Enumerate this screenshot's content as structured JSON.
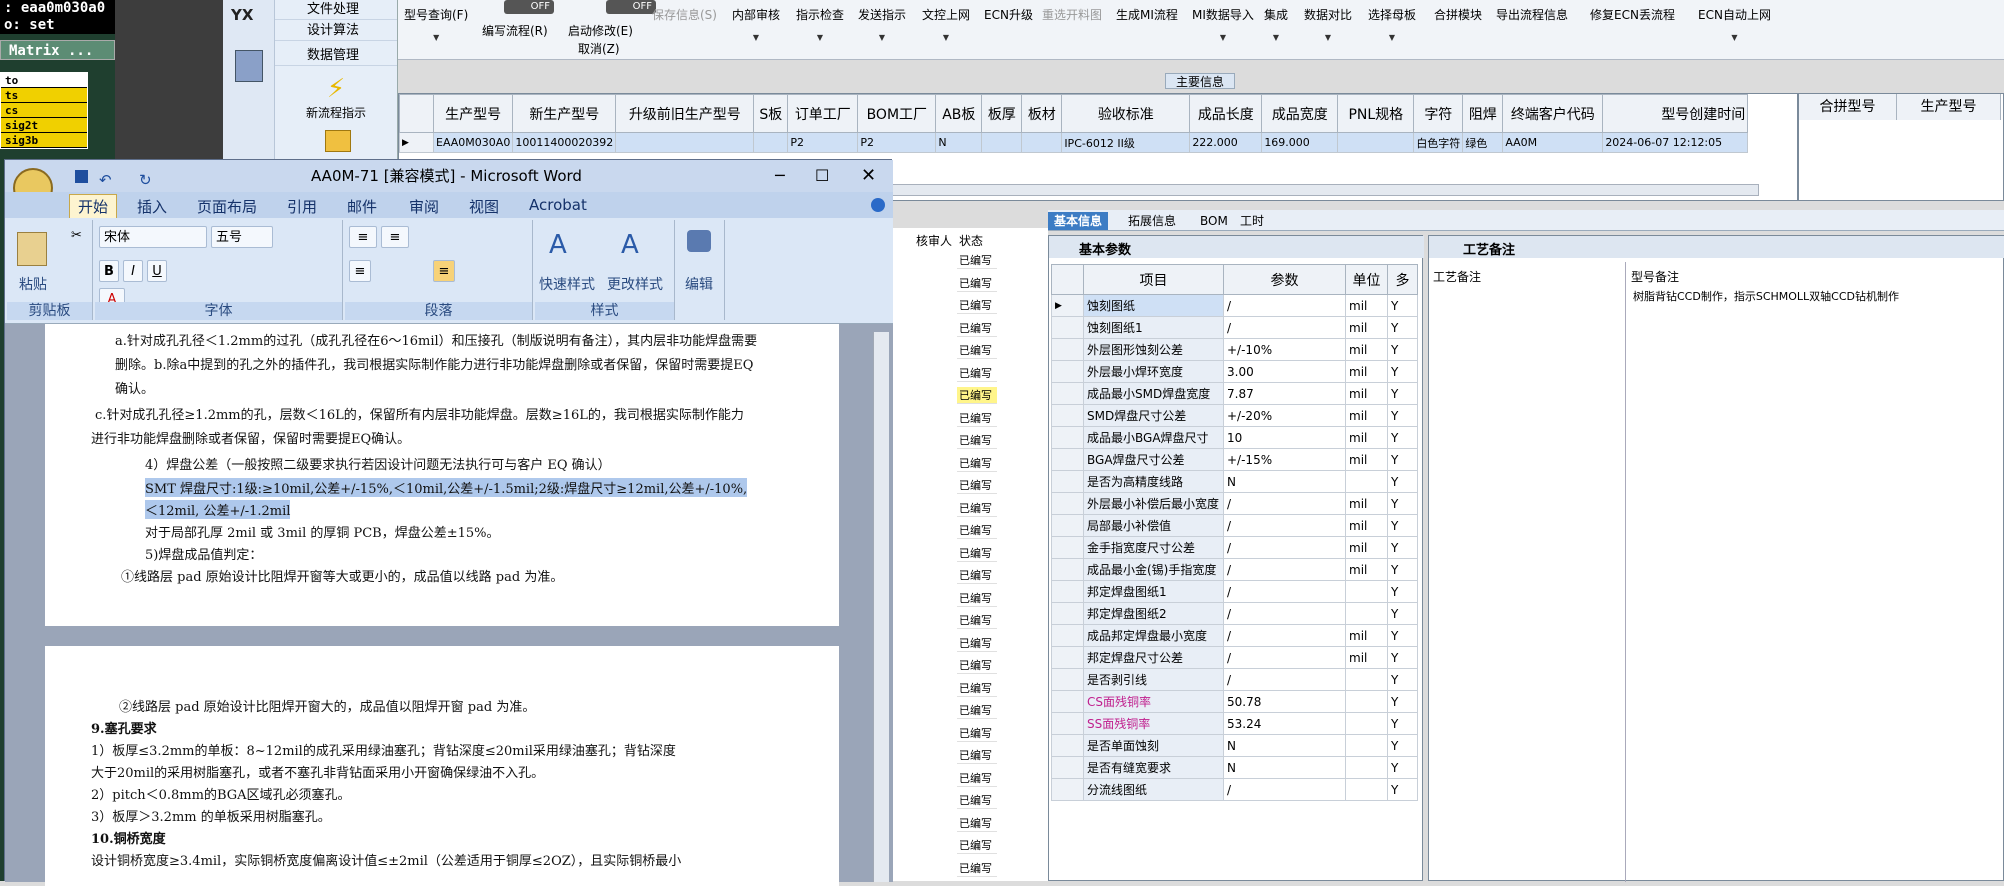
{
  "terminal": {
    "line1": ": eaa0m030a0",
    "line2": "o: set",
    "matrix": "Matrix ...",
    "items": [
      "to",
      "ts",
      "cs",
      "sig2t",
      "sig3b"
    ]
  },
  "nav": {
    "items": [
      "文件处理",
      "设计算法",
      "数据管理"
    ],
    "new_flow": "新流程指示",
    "app_logo": "YX"
  },
  "toolbar": {
    "toggle_off": "OFF",
    "buttons": [
      "型号查询(F)",
      "编写流程(R)",
      "启动修改(E)",
      "取消(Z)",
      "保存信息(S)",
      "内部审核",
      "指示检查",
      "发送指示",
      "文控上网",
      "ECN升级",
      "重选开料图",
      "生成MI流程",
      "MI数据导入",
      "集成",
      "数据对比",
      "选择母板",
      "合拼模块",
      "导出流程信息",
      "修复ECN丢流程",
      "ECN自动上网"
    ]
  },
  "main_info_label": "主要信息",
  "main_grid": {
    "headers": [
      "生产型号",
      "新生产型号",
      "升级前旧生产型号",
      "S板",
      "订单工厂",
      "BOM工厂",
      "AB板",
      "板厚",
      "板材",
      "验收标准",
      "成品长度",
      "成品宽度",
      "PNL规格",
      "字符",
      "阻焊",
      "终端客户代码",
      "型号创建时间"
    ],
    "row": [
      "EAA0M030A0",
      "10011400020392",
      "",
      "",
      "P2",
      "P2",
      "N",
      "",
      "",
      "IPC-6012 II级",
      "222.000",
      "169.000",
      "",
      "白色字符",
      "绿色",
      "AA0M",
      "2024-06-07 12:12:05"
    ]
  },
  "right_grid": {
    "headers": [
      "合拼型号",
      "生产型号"
    ]
  },
  "word": {
    "title": "AA0M-71 [兼容模式] - Microsoft Word",
    "tabs": [
      "开始",
      "插入",
      "页面布局",
      "引用",
      "邮件",
      "审阅",
      "视图",
      "Acrobat"
    ],
    "font_name": "宋体",
    "font_size": "五号",
    "groups": [
      "剪贴板",
      "字体",
      "段落",
      "样式",
      "编辑"
    ],
    "paste": "粘贴",
    "quick_style": "快速样式",
    "change_style": "更改样式",
    "edit": "编辑",
    "page1": [
      "a.针对成孔孔径＜1.2mm的过孔（成孔孔径在6～16mil）和压接孔（制版说明有备注），其内层非功能焊盘需要",
      "删除。b.除a中提到的孔之外的插件孔，我司根据实际制作能力进行非功能焊盘删除或者保留，保留时需要提EQ",
      "确认。",
      "c.针对成孔孔径≥1.2mm的孔，层数＜16L的，保留所有内层非功能焊盘。层数≥16L的，我司根据实际制作能力",
      "进行非功能焊盘删除或者保留，保留时需要提EQ确认。",
      "4）焊盘公差（一般按照二级要求执行若因设计问题无法执行可与客户 EQ 确认）",
      "SMT 焊盘尺寸:1级:≥10mil,公差+/-15%,＜10mil,公差+/-1.5mil;2级:焊盘尺寸≥12mil,公差+/-10%,",
      "＜12mil, 公差+/-1.2mil",
      "对于局部孔厚 2mil 或 3mil 的厚铜 PCB，焊盘公差±15%。",
      "5)焊盘成品值判定：",
      "①线路层 pad 原始设计比阻焊开窗等大或更小的，成品值以线路 pad 为准。"
    ],
    "page2": [
      "②线路层 pad 原始设计比阻焊开窗大的，成品值以阻焊开窗 pad 为准。",
      "9.塞孔要求",
      "1）板厚≤3.2mm的单板：8~12mil的成孔采用绿油塞孔；背钻深度≤20mil采用绿油塞孔；背钻深度",
      "大于20mil的采用树脂塞孔，或者不塞孔非背钻面采用小开窗确保绿油不入孔。",
      "2）pitch＜0.8mm的BGA区域孔必须塞孔。",
      "3）板厚＞3.2mm 的单板采用树脂塞孔。",
      "10.铜桥宽度",
      "设计铜桥宽度≥3.4mil，实际铜桥宽度偏离设计值≤±2mil（公差适用于铜厚≤2OZ），且实际铜桥最小"
    ]
  },
  "middle": {
    "headers": [
      "核审人",
      "状态"
    ],
    "status": "已编写"
  },
  "right_tabs": [
    "基本信息",
    "拓展信息",
    "BOM",
    "工时"
  ],
  "basic": {
    "section": "基本参数",
    "headers": [
      "项目",
      "参数",
      "单位",
      "多"
    ],
    "rows": [
      [
        "蚀刻图纸",
        "/",
        "mil",
        "Y"
      ],
      [
        "蚀刻图纸1",
        "/",
        "mil",
        "Y"
      ],
      [
        "外层图形蚀刻公差",
        "+/-10%",
        "mil",
        "Y"
      ],
      [
        "外层最小焊环宽度",
        "3.00",
        "mil",
        "Y"
      ],
      [
        "成品最小SMD焊盘宽度",
        "7.87",
        "mil",
        "Y"
      ],
      [
        "SMD焊盘尺寸公差",
        "+/-20%",
        "mil",
        "Y"
      ],
      [
        "成品最小BGA焊盘尺寸",
        "10",
        "mil",
        "Y"
      ],
      [
        "BGA焊盘尺寸公差",
        "+/-15%",
        "mil",
        "Y"
      ],
      [
        "是否为高精度线路",
        "N",
        "",
        "Y"
      ],
      [
        "外层最小补偿后最小宽度",
        "/",
        "mil",
        "Y"
      ],
      [
        "局部最小补偿值",
        "/",
        "mil",
        "Y"
      ],
      [
        "金手指宽度尺寸公差",
        "/",
        "mil",
        "Y"
      ],
      [
        "成品最小金(锡)手指宽度",
        "/",
        "mil",
        "Y"
      ],
      [
        "邦定焊盘图纸1",
        "/",
        "",
        "Y"
      ],
      [
        "邦定焊盘图纸2",
        "/",
        "",
        "Y"
      ],
      [
        "成品邦定焊盘最小宽度",
        "/",
        "mil",
        "Y"
      ],
      [
        "邦定焊盘尺寸公差",
        "/",
        "mil",
        "Y"
      ],
      [
        "是否剥引线",
        "/",
        "",
        "Y"
      ],
      [
        "CS面残铜率",
        "50.78",
        "",
        "Y"
      ],
      [
        "SS面残铜率",
        "53.24",
        "",
        "Y"
      ],
      [
        "是否单面蚀刻",
        "N",
        "",
        "Y"
      ],
      [
        "是否有缝宽要求",
        "N",
        "",
        "Y"
      ],
      [
        "分流线图纸",
        "/",
        "",
        "Y"
      ]
    ]
  },
  "process": {
    "section": "工艺备注",
    "col1": "工艺备注",
    "col2": "型号备注",
    "note": "树脂背钻CCD制作，指示SCHMOLL双轴CCD钻机制作"
  }
}
